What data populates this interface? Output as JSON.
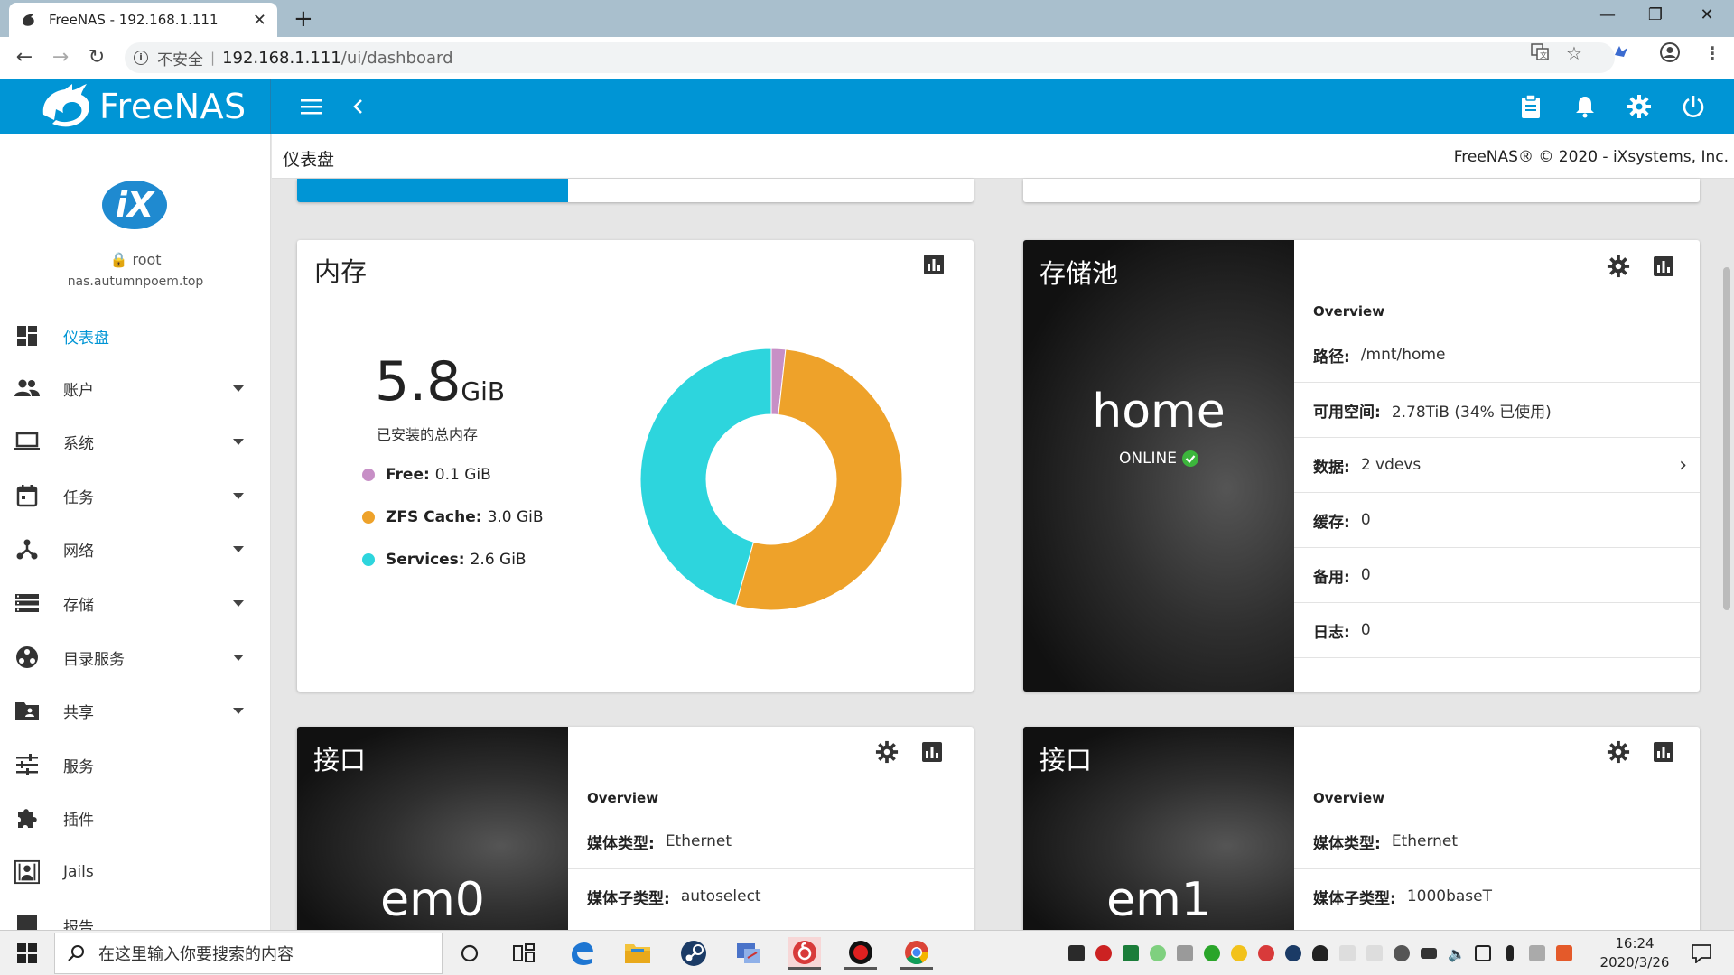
{
  "browser": {
    "tab_title": "FreeNAS - 192.168.1.111",
    "security_label": "不安全",
    "url_host": "192.168.1.111",
    "url_path": "/ui/dashboard"
  },
  "app": {
    "brand": "FreeNAS",
    "accent": "#0095d5"
  },
  "user": {
    "name": "root",
    "hostname": "nas.autumnpoem.top"
  },
  "sidebar": {
    "items": [
      {
        "label": "仪表盘",
        "icon": "dashboard-icon",
        "expandable": false
      },
      {
        "label": "账户",
        "icon": "people-icon",
        "expandable": true
      },
      {
        "label": "系统",
        "icon": "laptop-icon",
        "expandable": true
      },
      {
        "label": "任务",
        "icon": "calendar-icon",
        "expandable": true
      },
      {
        "label": "网络",
        "icon": "network-icon",
        "expandable": true
      },
      {
        "label": "存储",
        "icon": "storage-icon",
        "expandable": true
      },
      {
        "label": "目录服务",
        "icon": "directory-icon",
        "expandable": true
      },
      {
        "label": "共享",
        "icon": "share-folder-icon",
        "expandable": true
      },
      {
        "label": "服务",
        "icon": "sliders-icon",
        "expandable": false
      },
      {
        "label": "插件",
        "icon": "puzzle-icon",
        "expandable": false
      },
      {
        "label": "Jails",
        "icon": "jail-icon",
        "expandable": false
      },
      {
        "label": "报告",
        "icon": "report-icon",
        "expandable": false
      }
    ]
  },
  "header": {
    "page_title": "仪表盘",
    "copyright": "FreeNAS® © 2020 - iXsystems, Inc."
  },
  "memory": {
    "title": "内存",
    "total_value": "5.8",
    "total_unit": "GiB",
    "total_label": "已安装的总内存",
    "legend": [
      {
        "key": "Free:",
        "value": "0.1 GiB",
        "color": "#c78fc6"
      },
      {
        "key": "ZFS Cache:",
        "value": "3.0 GiB",
        "color": "#eea22a"
      },
      {
        "key": "Services:",
        "value": "2.6 GiB",
        "color": "#2dd5dd"
      }
    ],
    "chart_data": {
      "type": "pie",
      "categories": [
        "Free",
        "ZFS Cache",
        "Services"
      ],
      "values": [
        0.1,
        3.0,
        2.6
      ],
      "colors": [
        "#c78fc6",
        "#eea22a",
        "#2dd5dd"
      ]
    }
  },
  "pool": {
    "title": "存储池",
    "name": "home",
    "status": "ONLINE",
    "overview_label": "Overview",
    "rows": [
      {
        "key": "路径:",
        "value": "/mnt/home",
        "chevron": false
      },
      {
        "key": "可用空间:",
        "value": "2.78TiB  (34% 已使用)",
        "chevron": true
      },
      {
        "key": "数据:",
        "value": "2 vdevs",
        "chevron": true
      },
      {
        "key": "缓存:",
        "value": "0",
        "chevron": false
      },
      {
        "key": "备用:",
        "value": "0",
        "chevron": false
      },
      {
        "key": "日志:",
        "value": "0",
        "chevron": false
      }
    ]
  },
  "interfaces": [
    {
      "title": "接口",
      "name": "em0",
      "overview_label": "Overview",
      "rows": [
        {
          "key": "媒体类型:",
          "value": "Ethernet"
        },
        {
          "key": "媒体子类型:",
          "value": "autoselect"
        }
      ]
    },
    {
      "title": "接口",
      "name": "em1",
      "overview_label": "Overview",
      "rows": [
        {
          "key": "媒体类型:",
          "value": "Ethernet"
        },
        {
          "key": "媒体子类型:",
          "value": "1000baseT"
        }
      ]
    }
  ],
  "taskbar": {
    "search_placeholder": "在这里输入你要搜索的内容",
    "time": "16:24",
    "date": "2020/3/26"
  }
}
